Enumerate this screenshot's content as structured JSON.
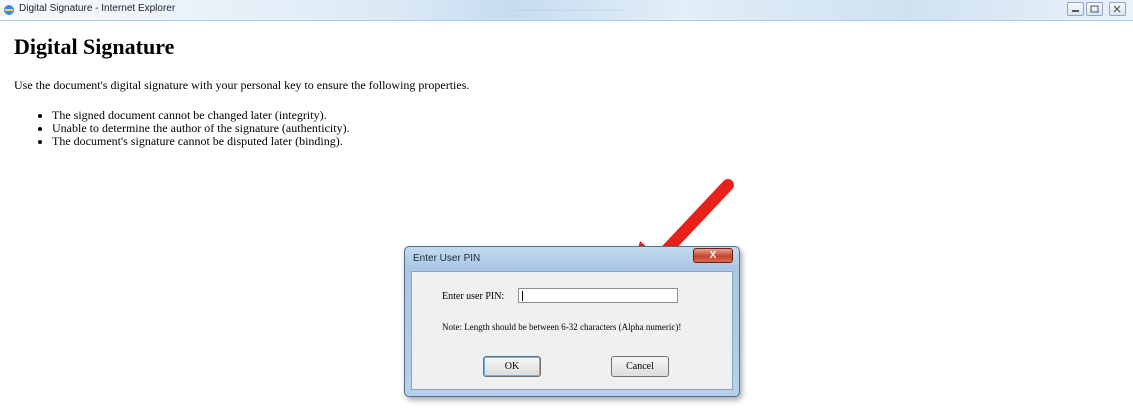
{
  "window": {
    "title": "Digital Signature - Internet Explorer",
    "faded_tab": "........................  ...............................",
    "buttons": [
      "minimize-icon",
      "restore-icon",
      "close-icon"
    ]
  },
  "page": {
    "heading": "Digital Signature",
    "intro": "Use the document's digital signature with your personal key to ensure the following properties.",
    "bullets": [
      "The signed document cannot be changed later (integrity).",
      "Unable to determine the author of the signature (authenticity).",
      "The document's signature cannot be disputed later (binding)."
    ]
  },
  "dialog": {
    "title": "Enter User PIN",
    "close_label": "X",
    "pin_label": "Enter user PIN:",
    "pin_value": "",
    "note": "Note: Length should be between 6-32 characters (Alpha numeric)!",
    "ok_label": "OK",
    "cancel_label": "Cancel"
  },
  "colors": {
    "arrow": "#e8221b",
    "close_button": "#c8432d",
    "dialog_frame": "#a9c6e4"
  }
}
